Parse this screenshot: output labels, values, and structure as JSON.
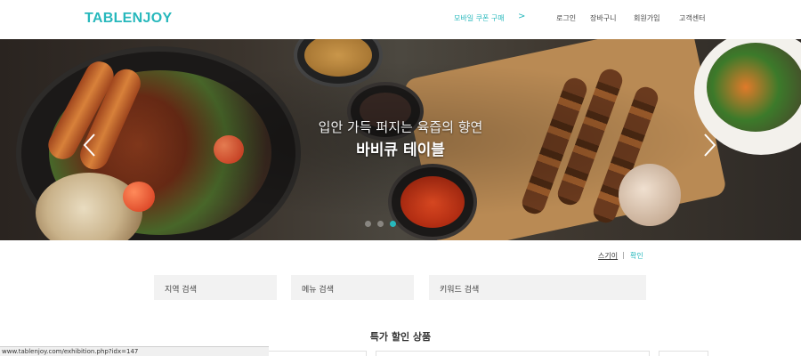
{
  "header": {
    "logo": "TABLENJOY",
    "promo_label": "모바일 쿠폰 구매",
    "promo_arrow": ">",
    "nav": [
      "로그인",
      "장바구니",
      "회원가입",
      "고객센터"
    ]
  },
  "hero": {
    "subtitle": "입안 가득 퍼지는 육즙의 향연",
    "title": "바비큐 테이블",
    "slide_count": 3,
    "active_slide": 3
  },
  "search_toggle": {
    "collapse": "스기이",
    "separator": "|",
    "confirm": "확인"
  },
  "search": {
    "region": "지역 검색",
    "menu": "메뉴 검색",
    "keyword": "키워드 검색"
  },
  "section": {
    "title": "특가 할인 상품"
  },
  "status_bar": {
    "url": "www.tablenjoy.com/exhibition.php?idx=147"
  },
  "colors": {
    "accent": "#27b8bc",
    "search_bg": "#f2f2f2"
  }
}
